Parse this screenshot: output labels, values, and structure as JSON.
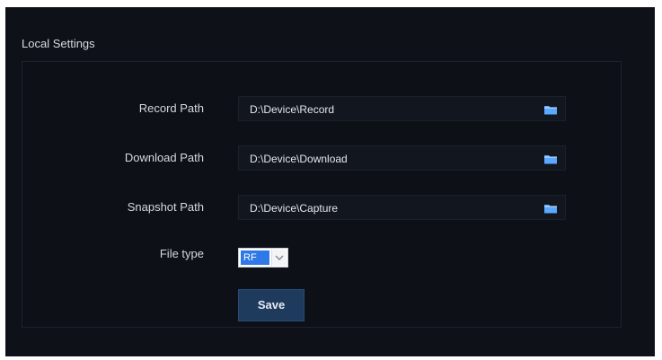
{
  "page": {
    "section_title": "Local Settings"
  },
  "settings": {
    "record_path": {
      "label": "Record Path",
      "value": "D:\\Device\\Record",
      "icon": "folder-icon"
    },
    "download_path": {
      "label": "Download Path",
      "value": "D:\\Device\\Download",
      "icon": "folder-icon"
    },
    "snapshot_path": {
      "label": "Snapshot Path",
      "value": "D:\\Device\\Capture",
      "icon": "folder-icon"
    },
    "file_type": {
      "label": "File type",
      "selected": "RF"
    },
    "save_label": "Save"
  },
  "colors": {
    "background": "#0e1118",
    "field_background": "#12161f",
    "accent_blue": "#2f78e8",
    "button_background": "#1e3a5c"
  }
}
